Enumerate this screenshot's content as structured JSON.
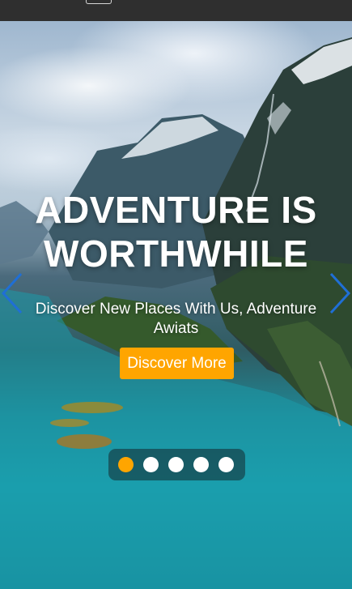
{
  "header": {
    "menu_icon": "hamburger-menu-icon"
  },
  "hero": {
    "title_line1": "ADVENTURE IS",
    "title_line2": "WORTHWHILE",
    "subtitle": "Discover New Places With Us, Adventure Awiats",
    "cta_label": "Discover More",
    "prev_icon": "chevron-left-icon",
    "next_icon": "chevron-right-icon",
    "slides_total": 5,
    "active_slide": 1,
    "background_image": "fjord-landscape"
  },
  "colors": {
    "accent": "#ffa500",
    "arrow": "#1f6fd6",
    "topbar": "#2f2f2f",
    "text": "#ffffff"
  }
}
